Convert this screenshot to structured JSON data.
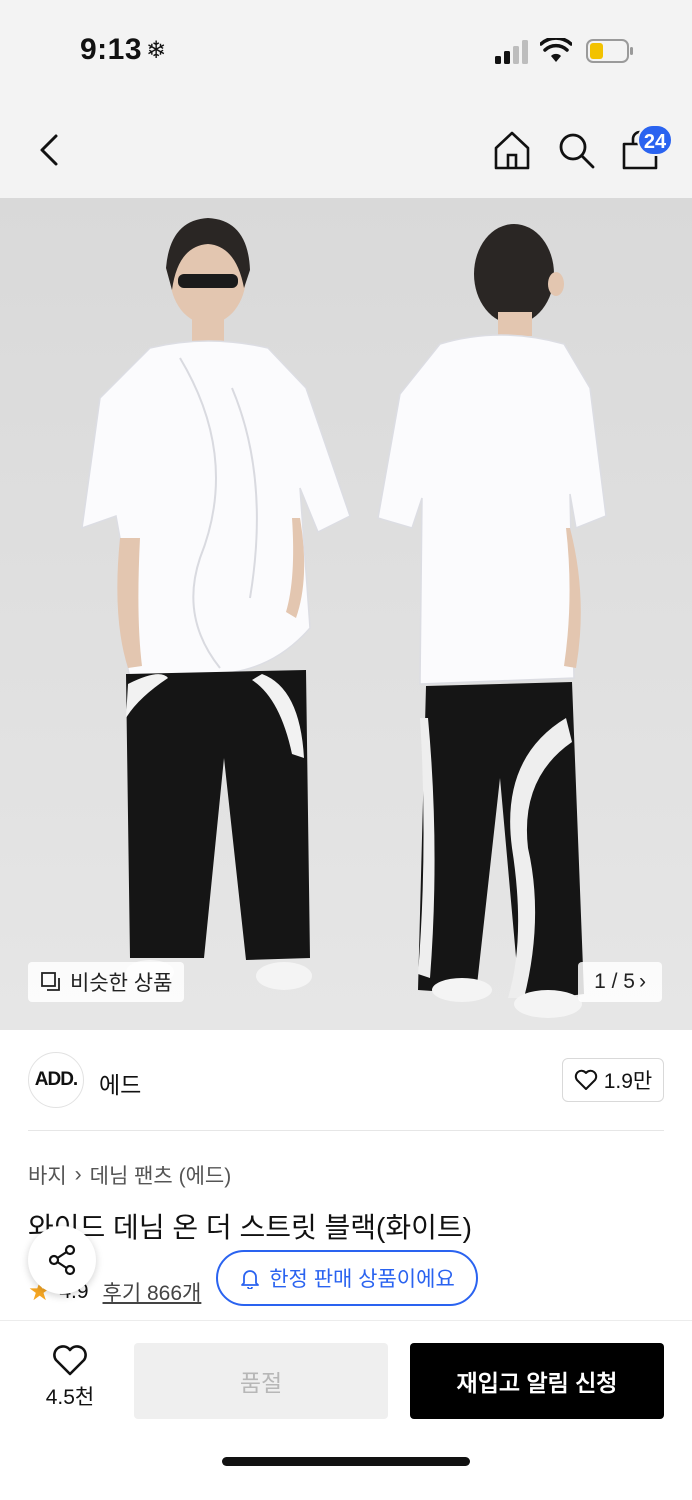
{
  "status_bar": {
    "time": "9:13",
    "weather_icon": "snowflake-icon"
  },
  "navbar": {
    "cart_count": "24"
  },
  "gallery": {
    "similar_label": "비슷한 상품",
    "pager": "1 / 5"
  },
  "brand": {
    "logo_text": "ADD.",
    "name": "에드",
    "like_count": "1.9만"
  },
  "product": {
    "breadcrumb": [
      "바지",
      "데님 팬츠 (에드)"
    ],
    "title": "와이드 데님 온 더 스트릿 블랙(화이트)",
    "rating": "4.9",
    "review_label": "후기 866개",
    "limited_label": "한정 판매 상품이에요"
  },
  "bottom_bar": {
    "wish_count": "4.5천",
    "soldout_label": "품절",
    "restock_label": "재입고 알림 신청"
  },
  "colors": {
    "accent_blue": "#2a63f0",
    "star_orange": "#f5a623",
    "black": "#000000"
  }
}
